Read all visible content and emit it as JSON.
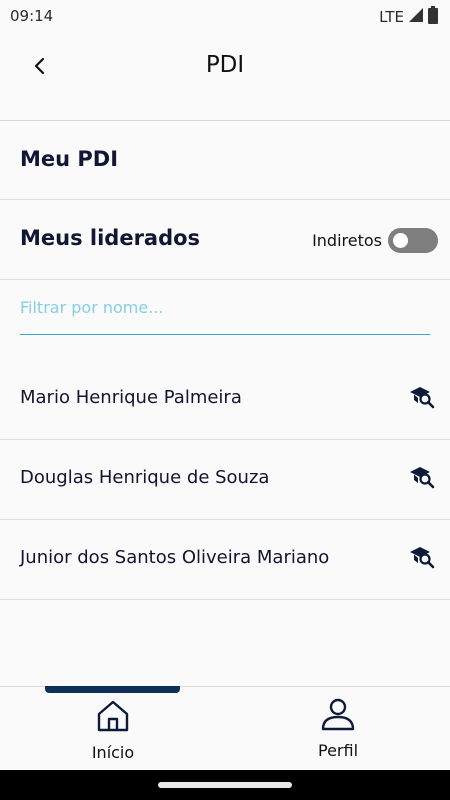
{
  "status_bar": {
    "time": "09:14",
    "network": "LTE"
  },
  "app_bar": {
    "title": "PDI"
  },
  "my_pdi": {
    "label": "Meu PDI"
  },
  "led": {
    "title": "Meus liderados",
    "indirect_label": "Indiretos",
    "indirect_enabled": false
  },
  "filter": {
    "placeholder": "Filtrar por nome..."
  },
  "leaders": [
    {
      "name": "Mario Henrique Palmeira"
    },
    {
      "name": "Douglas Henrique de Souza"
    },
    {
      "name": "Junior dos Santos Oliveira Mariano"
    }
  ],
  "bottom_nav": {
    "items": [
      {
        "label": "Início",
        "icon": "home-icon",
        "selected": true
      },
      {
        "label": "Perfil",
        "icon": "person-icon",
        "selected": false
      }
    ]
  },
  "colors": {
    "accent": "#0f2f57",
    "filter_underline": "#3aa7c9",
    "toggle_off": "#7e7e7e"
  }
}
